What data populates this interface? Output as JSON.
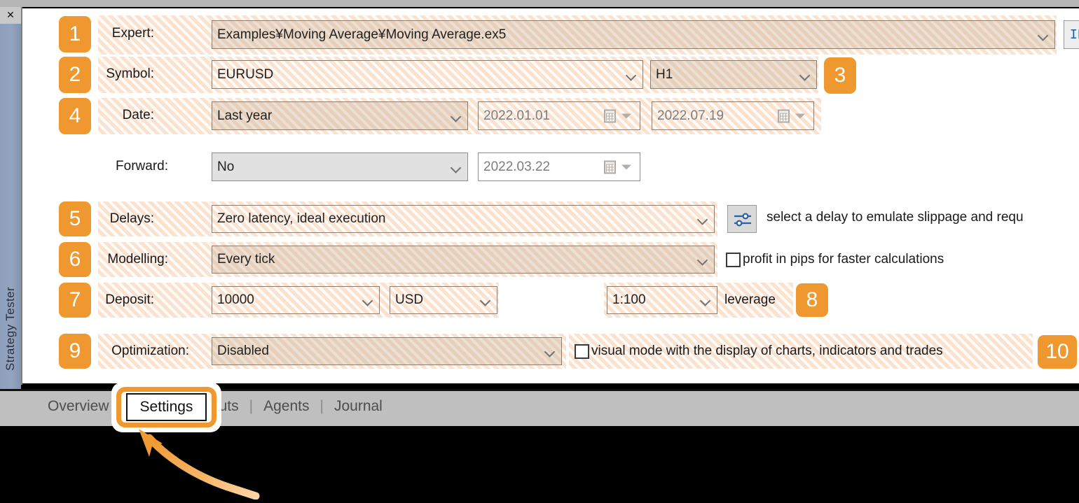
{
  "window": {
    "sidebar_label": "Strategy Tester",
    "close_icon": "close-icon",
    "close_glyph": "✕"
  },
  "colors": {
    "badge_orange": "#ee982f",
    "highlight_hatch": "#fae2cf",
    "sidebar_blue": "#8fa0bb",
    "tabbar_gray": "#bfbfbf",
    "id_button_text": "#1c5fb0"
  },
  "form": {
    "expert": {
      "label": "Expert:",
      "value": "Examples¥Moving Average¥Moving Average.ex5",
      "badge": "1"
    },
    "symbol": {
      "label": "Symbol:",
      "value": "EURUSD",
      "badge": "2"
    },
    "timeframe": {
      "value": "H1",
      "badge": "3"
    },
    "date": {
      "label": "Date:",
      "value": "Last year",
      "from": "2022.01.01",
      "to": "2022.07.19",
      "badge": "4"
    },
    "forward": {
      "label": "Forward:",
      "value": "No",
      "date": "2022.03.22"
    },
    "delays": {
      "label": "Delays:",
      "value": "Zero latency, ideal execution",
      "hint": "select a delay to emulate slippage and requ",
      "button_icon": "sliders-icon",
      "badge": "5"
    },
    "modelling": {
      "label": "Modelling:",
      "value": "Every tick",
      "checkbox_label": "profit in pips for faster calculations",
      "checkbox_checked": false,
      "badge": "6"
    },
    "deposit": {
      "label": "Deposit:",
      "value": "10000",
      "currency": "USD",
      "badge": "7"
    },
    "leverage": {
      "value": "1:100",
      "label": "leverage",
      "badge": "8"
    },
    "optimization": {
      "label": "Optimization:",
      "value": "Disabled",
      "checkbox_label": "visual mode with the display of charts, indicators and trades",
      "checkbox_checked": false,
      "badge": "9",
      "checkbox_badge": "10"
    },
    "id_button": {
      "label": "ID"
    }
  },
  "tabs": {
    "items": [
      {
        "label": "Overview",
        "active": false
      },
      {
        "label": "Settings",
        "active": true
      },
      {
        "label": "Inputs",
        "active": false
      },
      {
        "label": "Agents",
        "active": false
      },
      {
        "label": "Journal",
        "active": false
      }
    ],
    "separator": "|",
    "callout_target": "Settings"
  }
}
